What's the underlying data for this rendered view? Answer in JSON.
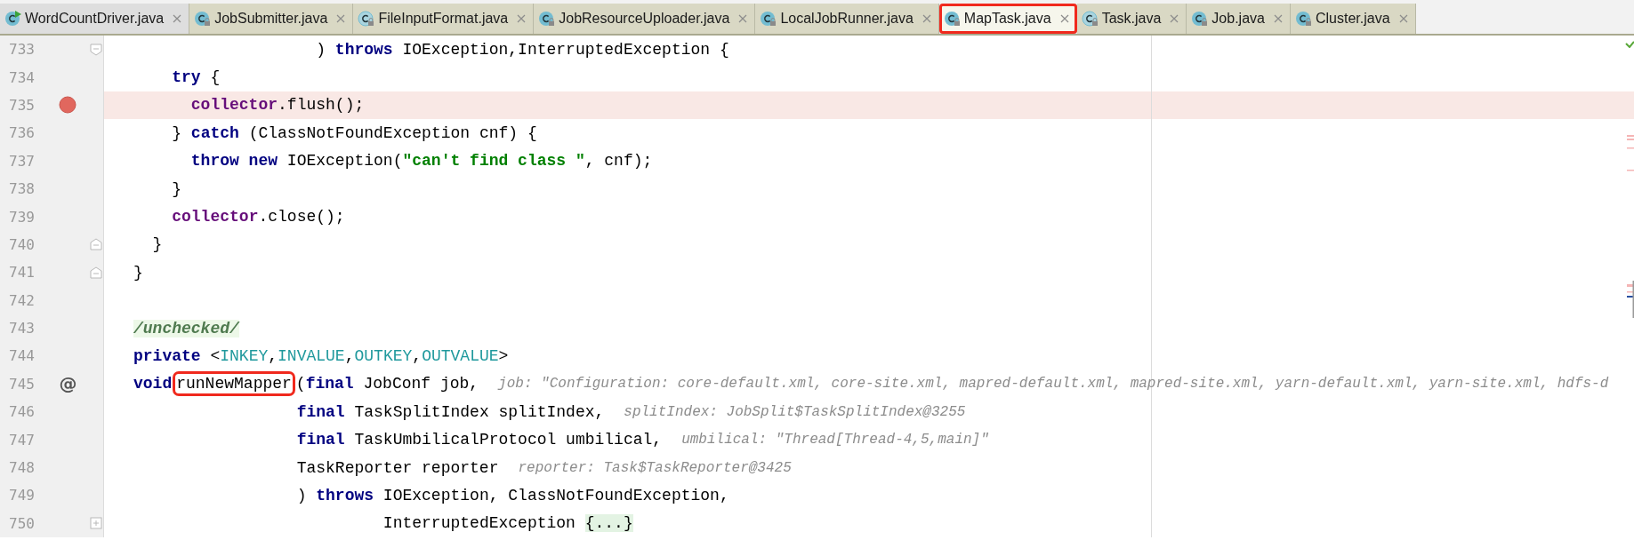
{
  "tabs": [
    {
      "label": "WordCountDriver.java",
      "kind": "runnable",
      "selected": false,
      "highlighted": false
    },
    {
      "label": "JobSubmitter.java",
      "kind": "class",
      "selected": false,
      "highlighted": false
    },
    {
      "label": "FileInputFormat.java",
      "kind": "abstract",
      "selected": false,
      "highlighted": false
    },
    {
      "label": "JobResourceUploader.java",
      "kind": "class",
      "selected": false,
      "highlighted": false
    },
    {
      "label": "LocalJobRunner.java",
      "kind": "class",
      "selected": false,
      "highlighted": false
    },
    {
      "label": "MapTask.java",
      "kind": "class",
      "selected": true,
      "highlighted": true
    },
    {
      "label": "Task.java",
      "kind": "abstract",
      "selected": false,
      "highlighted": false
    },
    {
      "label": "Job.java",
      "kind": "class",
      "selected": false,
      "highlighted": false
    },
    {
      "label": "Cluster.java",
      "kind": "class",
      "selected": false,
      "highlighted": false
    }
  ],
  "editor": {
    "lines": [
      {
        "number": "733",
        "gutter": {
          "kind": "fold-start"
        },
        "current": false,
        "tokens": [
          {
            "text": "                   ) ",
            "kind": "plain"
          },
          {
            "text": "throws",
            "kind": "kw"
          },
          {
            "text": " IOException,InterruptedException {",
            "kind": "plain"
          }
        ]
      },
      {
        "number": "734",
        "current": false,
        "tokens": [
          {
            "text": "    try",
            "kind": "kw"
          },
          {
            "text": " {",
            "kind": "plain"
          }
        ]
      },
      {
        "number": "735",
        "gutter": {
          "kind": "breakpoint"
        },
        "current": true,
        "tokens": [
          {
            "text": "      collector",
            "kind": "field"
          },
          {
            "text": ".flush();",
            "kind": "plain"
          }
        ]
      },
      {
        "number": "736",
        "current": false,
        "tokens": [
          {
            "text": "    } ",
            "kind": "plain"
          },
          {
            "text": "catch",
            "kind": "kw"
          },
          {
            "text": " (ClassNotFoundException cnf) {",
            "kind": "plain"
          }
        ]
      },
      {
        "number": "737",
        "current": false,
        "tokens": [
          {
            "text": "      throw new",
            "kind": "kw"
          },
          {
            "text": " IOException(",
            "kind": "plain"
          },
          {
            "text": "\"can't find class \"",
            "kind": "str"
          },
          {
            "text": ", cnf);",
            "kind": "plain"
          }
        ]
      },
      {
        "number": "738",
        "current": false,
        "tokens": [
          {
            "text": "    }",
            "kind": "plain"
          }
        ]
      },
      {
        "number": "739",
        "current": false,
        "tokens": [
          {
            "text": "    collector",
            "kind": "field"
          },
          {
            "text": ".close();",
            "kind": "plain"
          }
        ]
      },
      {
        "number": "740",
        "gutter": {
          "kind": "fold-end"
        },
        "current": false,
        "tokens": [
          {
            "text": "  }",
            "kind": "plain"
          }
        ]
      },
      {
        "number": "741",
        "gutter": {
          "kind": "fold-end"
        },
        "current": false,
        "tokens": [
          {
            "text": "}",
            "kind": "plain"
          }
        ]
      },
      {
        "number": "742",
        "current": false
      },
      {
        "number": "743",
        "current": false,
        "tokens": [
          {
            "text": "/unchecked/",
            "kind": "comment"
          }
        ]
      },
      {
        "number": "744",
        "current": false,
        "tokens": [
          {
            "text": "private",
            "kind": "kw"
          },
          {
            "text": " <",
            "kind": "plain"
          },
          {
            "text": "INKEY",
            "kind": "tparam"
          },
          {
            "text": ",",
            "kind": "plain"
          },
          {
            "text": "INVALUE",
            "kind": "tparam"
          },
          {
            "text": ",",
            "kind": "plain"
          },
          {
            "text": "OUTKEY",
            "kind": "tparam"
          },
          {
            "text": ",",
            "kind": "plain"
          },
          {
            "text": "OUTVALUE",
            "kind": "tparam"
          },
          {
            "text": ">",
            "kind": "plain"
          }
        ]
      },
      {
        "number": "745",
        "gutter": {
          "kind": "text",
          "text": "@"
        },
        "current": false,
        "tokens": [
          {
            "text": "void",
            "kind": "kw"
          },
          {
            "text": "runNewMapper",
            "kind": "boxed"
          },
          {
            "text": "(",
            "kind": "plain"
          },
          {
            "text": "final",
            "kind": "kw"
          },
          {
            "text": " JobConf job,",
            "kind": "plain"
          },
          {
            "text": "job: \"Configuration: core-default.xml, core-site.xml, mapred-default.xml, mapred-site.xml, yarn-default.xml, yarn-site.xml, hdfs-d",
            "kind": "hint"
          }
        ]
      },
      {
        "number": "746",
        "current": false,
        "tokens": [
          {
            "text": "                 final",
            "kind": "kw"
          },
          {
            "text": " TaskSplitIndex splitIndex,",
            "kind": "plain"
          },
          {
            "text": "splitIndex: JobSplit$TaskSplitIndex@3255",
            "kind": "hint"
          }
        ]
      },
      {
        "number": "747",
        "current": false,
        "tokens": [
          {
            "text": "                 final",
            "kind": "kw"
          },
          {
            "text": " TaskUmbilicalProtocol umbilical,",
            "kind": "plain"
          },
          {
            "text": "umbilical: \"Thread[Thread-4,5,main]\"",
            "kind": "hint"
          }
        ]
      },
      {
        "number": "748",
        "current": false,
        "tokens": [
          {
            "text": "                 TaskReporter reporter",
            "kind": "plain"
          },
          {
            "text": "reporter: Task$TaskReporter@3425",
            "kind": "hint"
          }
        ]
      },
      {
        "number": "749",
        "current": false,
        "tokens": [
          {
            "text": "                 ) ",
            "kind": "plain"
          },
          {
            "text": "throws",
            "kind": "kw"
          },
          {
            "text": " IOException, ClassNotFoundException,",
            "kind": "plain"
          }
        ]
      },
      {
        "number": "750",
        "gutter": {
          "kind": "collapsed"
        },
        "current": false,
        "tokens": [
          {
            "text": "                          InterruptedException ",
            "kind": "plain"
          },
          {
            "text": "{...}",
            "kind": "fold"
          }
        ]
      }
    ]
  }
}
